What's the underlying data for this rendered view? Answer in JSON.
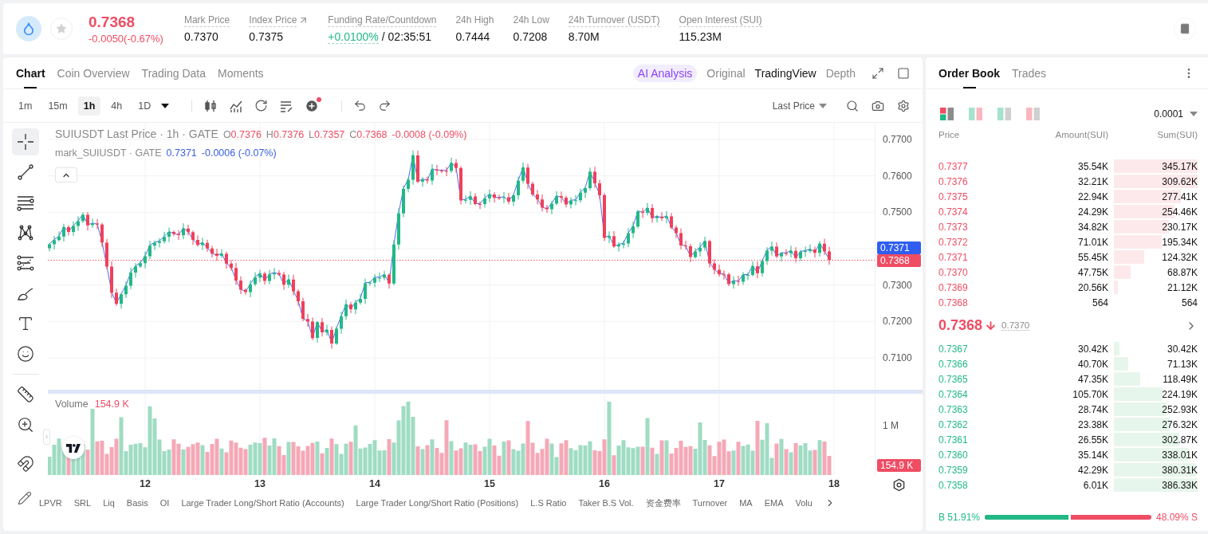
{
  "header": {
    "price": "0.7368",
    "change": "-0.0050(-0.67%)",
    "favorited": false,
    "stats": [
      {
        "kind": "plain",
        "label": "Mark Price",
        "value": "0.7370",
        "underlined": true
      },
      {
        "kind": "link",
        "label": "Index Price",
        "value": "0.7375",
        "underlined": true
      },
      {
        "kind": "funding",
        "label": "Funding Rate/Countdown",
        "value": "+0.0100%",
        "countdown": "/ 02:35:51",
        "underlined": true
      },
      {
        "kind": "plain",
        "label": "24h High",
        "value": "0.7444",
        "underlined": false
      },
      {
        "kind": "plain",
        "label": "24h Low",
        "value": "0.7208",
        "underlined": false
      },
      {
        "kind": "plain",
        "label": "24h Turnover (USDT)",
        "value": "8.70M",
        "underlined": true
      },
      {
        "kind": "plain",
        "label": "Open Interest (SUI)",
        "value": "115.23M",
        "underlined": true
      }
    ]
  },
  "chart": {
    "tabs": [
      {
        "label": "Chart",
        "selected": true
      },
      {
        "label": "Coin Overview",
        "selected": false
      },
      {
        "label": "Trading Data",
        "selected": false
      },
      {
        "label": "Moments",
        "selected": false
      }
    ],
    "views": [
      {
        "kind": "ai",
        "label": "AI Analysis",
        "selected": false
      },
      {
        "kind": "text",
        "label": "Original",
        "selected": false
      },
      {
        "kind": "text",
        "label": "TradingView",
        "selected": true
      },
      {
        "kind": "text",
        "label": "Depth",
        "selected": false
      }
    ],
    "intervals": [
      {
        "label": "1m",
        "selected": false
      },
      {
        "label": "15m",
        "selected": false
      },
      {
        "label": "1h",
        "selected": true
      },
      {
        "label": "4h",
        "selected": false
      },
      {
        "label": "1D",
        "selected": false
      }
    ],
    "indicator_badge": true,
    "price_source": "Last Price",
    "tools": [
      {
        "kind": "crosshair",
        "selected": true
      },
      {
        "kind": "trend-line",
        "selected": false
      },
      {
        "kind": "parallel-lines",
        "selected": false
      },
      {
        "kind": "pattern",
        "selected": false
      },
      {
        "kind": "fibonacci",
        "selected": false
      },
      {
        "kind": "brush",
        "selected": false
      },
      {
        "kind": "text",
        "selected": false
      },
      {
        "kind": "emoji",
        "selected": false
      },
      {
        "kind": "ruler",
        "selected": false
      },
      {
        "kind": "zoom",
        "selected": false
      },
      {
        "kind": "magnet",
        "selected": false
      }
    ],
    "legend": {
      "title": "SUIUSDT Last Price · 1h · GATE",
      "ohlc": [
        {
          "key": "O",
          "value": "0.7376"
        },
        {
          "key": "H",
          "value": "0.7376"
        },
        {
          "key": "L",
          "value": "0.7357"
        },
        {
          "key": "C",
          "value": "0.7368"
        }
      ],
      "change": "-0.0008 (-0.09%)",
      "mark_title": "mark_SUIUSDT · GATE",
      "mark_value": "0.7371",
      "mark_change": "-0.0006 (-0.07%)"
    },
    "price_axis": {
      "ticks": [
        "0.7700",
        "0.7600",
        "0.7500",
        "0.7300",
        "0.7200",
        "0.7100"
      ],
      "mark_price": "0.7371",
      "last_price": "0.7368"
    },
    "volume": {
      "title": "Volume",
      "value": "154.9 K",
      "tick": "1 M",
      "last": "154.9 K"
    },
    "time_axis": [
      "12",
      "13",
      "14",
      "15",
      "16",
      "17",
      "18"
    ],
    "indicators": [
      "LPVR",
      "SRL",
      "Liq",
      "Basis",
      "OI",
      "Large Trader Long/Short Ratio (Accounts)",
      "Large Trader Long/Short Ratio (Positions)",
      "L.S Ratio",
      "Taker B.S Vol.",
      "资金费率",
      "Turnover",
      "MA",
      "EMA",
      "Volu"
    ]
  },
  "order_book": {
    "tabs": [
      {
        "label": "Order Book",
        "selected": true
      },
      {
        "label": "Trades",
        "selected": false
      }
    ],
    "layouts": [
      {
        "kind": "both",
        "selected": true
      },
      {
        "kind": "split",
        "selected": false
      },
      {
        "kind": "bids",
        "selected": false
      },
      {
        "kind": "asks",
        "selected": false
      }
    ],
    "precision": "0.0001",
    "columns": [
      "Price",
      "Amount(SUI)",
      "Sum(SUI)"
    ],
    "asks": [
      {
        "price": "0.7377",
        "amount": "35.54K",
        "sum": "345.17K",
        "level": 1
      },
      {
        "price": "0.7376",
        "amount": "32.21K",
        "sum": "309.62K",
        "level": 1
      },
      {
        "price": "0.7375",
        "amount": "22.94K",
        "sum": "277.41K",
        "level": 0.8
      },
      {
        "price": "0.7374",
        "amount": "24.29K",
        "sum": "254.46K",
        "level": 0.72
      },
      {
        "price": "0.7373",
        "amount": "34.82K",
        "sum": "230.17K",
        "level": 0.66
      },
      {
        "price": "0.7372",
        "amount": "71.01K",
        "sum": "195.34K",
        "level": 0.57
      },
      {
        "price": "0.7371",
        "amount": "55.45K",
        "sum": "124.32K",
        "level": 0.36
      },
      {
        "price": "0.7370",
        "amount": "47.75K",
        "sum": "68.87K",
        "level": 0.2
      },
      {
        "price": "0.7369",
        "amount": "20.56K",
        "sum": "21.12K",
        "level": 0.05
      },
      {
        "price": "0.7368",
        "amount": "564",
        "sum": "564"
      }
    ],
    "last": {
      "price": "0.7368",
      "falling": true,
      "mark": "0.7370"
    },
    "bids": [
      {
        "price": "0.7367",
        "amount": "30.42K",
        "sum": "30.42K",
        "level": 0.07
      },
      {
        "price": "0.7366",
        "amount": "40.70K",
        "sum": "71.13K",
        "level": 0.17
      },
      {
        "price": "0.7365",
        "amount": "47.35K",
        "sum": "118.49K",
        "level": 0.31
      },
      {
        "price": "0.7364",
        "amount": "105.70K",
        "sum": "224.19K",
        "level": 0.58
      },
      {
        "price": "0.7363",
        "amount": "28.74K",
        "sum": "252.93K",
        "level": 0.63
      },
      {
        "price": "0.7362",
        "amount": "23.38K",
        "sum": "276.32K",
        "level": 0.67
      },
      {
        "price": "0.7361",
        "amount": "26.55K",
        "sum": "302.87K",
        "level": 0.78
      },
      {
        "price": "0.7360",
        "amount": "35.14K",
        "sum": "338.01K",
        "level": 0.89
      },
      {
        "price": "0.7359",
        "amount": "42.29K",
        "sum": "380.31K",
        "level": 0.98
      },
      {
        "price": "0.7358",
        "amount": "6.01K",
        "sum": "386.33K",
        "level": 1
      }
    ],
    "ratio": {
      "buy": "B 51.91%",
      "sell": "48.09% S",
      "level": 0.5191
    }
  }
}
